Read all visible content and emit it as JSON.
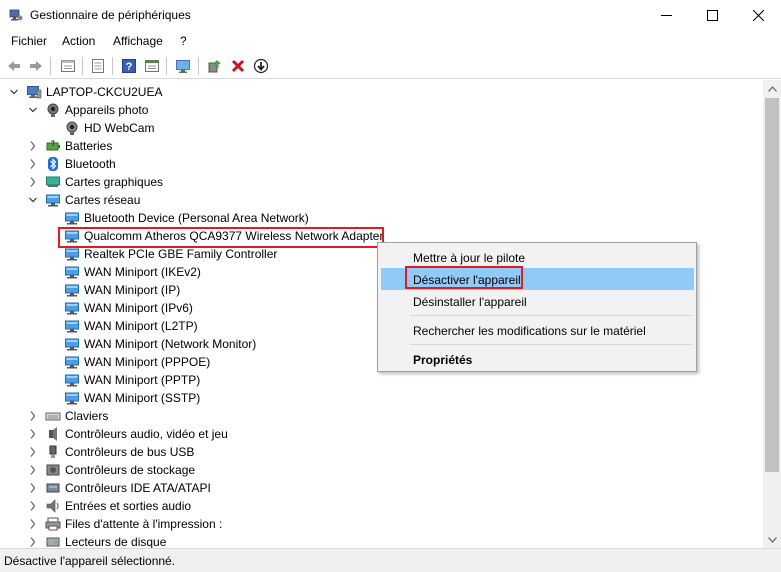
{
  "window": {
    "title": "Gestionnaire de périphériques",
    "controls": [
      "minimize",
      "maximize",
      "close"
    ]
  },
  "menubar": {
    "items": [
      "Fichier",
      "Action",
      "Affichage",
      "?"
    ]
  },
  "toolbar": {
    "buttons": [
      "back-arrow-icon",
      "forward-arrow-icon",
      "properties-sheet-icon",
      "list-view-icon",
      "help-icon",
      "action-panel-icon",
      "monitor-scan-icon",
      "update-driver-icon",
      "uninstall-x-icon",
      "disable-down-arrow-icon"
    ]
  },
  "tree": {
    "root": "LAPTOP-CKCU2UEA",
    "items": [
      {
        "label": "Appareils photo",
        "level": 1,
        "state": "expanded",
        "icon": "camera-icon"
      },
      {
        "label": "HD WebCam",
        "level": 2,
        "state": "leaf",
        "icon": "webcam-icon"
      },
      {
        "label": "Batteries",
        "level": 1,
        "state": "collapsed",
        "icon": "battery-icon"
      },
      {
        "label": "Bluetooth",
        "level": 1,
        "state": "collapsed",
        "icon": "bluetooth-icon"
      },
      {
        "label": "Cartes graphiques",
        "level": 1,
        "state": "collapsed",
        "icon": "display-adapter-icon"
      },
      {
        "label": "Cartes réseau",
        "level": 1,
        "state": "expanded",
        "icon": "network-adapter-icon"
      },
      {
        "label": "Bluetooth Device (Personal Area Network)",
        "level": 2,
        "state": "leaf",
        "icon": "network-adapter-icon"
      },
      {
        "label": "Qualcomm Atheros QCA9377 Wireless Network Adapter",
        "level": 2,
        "state": "leaf",
        "icon": "network-adapter-icon",
        "selected": true
      },
      {
        "label": "Realtek PCIe GBE Family Controller",
        "level": 2,
        "state": "leaf",
        "icon": "network-adapter-icon"
      },
      {
        "label": "WAN Miniport (IKEv2)",
        "level": 2,
        "state": "leaf",
        "icon": "network-adapter-icon"
      },
      {
        "label": "WAN Miniport (IP)",
        "level": 2,
        "state": "leaf",
        "icon": "network-adapter-icon"
      },
      {
        "label": "WAN Miniport (IPv6)",
        "level": 2,
        "state": "leaf",
        "icon": "network-adapter-icon"
      },
      {
        "label": "WAN Miniport (L2TP)",
        "level": 2,
        "state": "leaf",
        "icon": "network-adapter-icon"
      },
      {
        "label": "WAN Miniport (Network Monitor)",
        "level": 2,
        "state": "leaf",
        "icon": "network-adapter-icon"
      },
      {
        "label": "WAN Miniport (PPPOE)",
        "level": 2,
        "state": "leaf",
        "icon": "network-adapter-icon"
      },
      {
        "label": "WAN Miniport (PPTP)",
        "level": 2,
        "state": "leaf",
        "icon": "network-adapter-icon"
      },
      {
        "label": "WAN Miniport (SSTP)",
        "level": 2,
        "state": "leaf",
        "icon": "network-adapter-icon"
      },
      {
        "label": "Claviers",
        "level": 1,
        "state": "collapsed",
        "icon": "keyboard-icon"
      },
      {
        "label": "Contrôleurs audio, vidéo et jeu",
        "level": 1,
        "state": "collapsed",
        "icon": "audio-icon"
      },
      {
        "label": "Contrôleurs de bus USB",
        "level": 1,
        "state": "collapsed",
        "icon": "usb-icon"
      },
      {
        "label": "Contrôleurs de stockage",
        "level": 1,
        "state": "collapsed",
        "icon": "storage-icon"
      },
      {
        "label": "Contrôleurs IDE ATA/ATAPI",
        "level": 1,
        "state": "collapsed",
        "icon": "ide-icon"
      },
      {
        "label": "Entrées et sorties audio",
        "level": 1,
        "state": "collapsed",
        "icon": "speaker-icon"
      },
      {
        "label": "Files d'attente à l'impression :",
        "level": 1,
        "state": "collapsed",
        "icon": "printer-icon"
      },
      {
        "label": "Lecteurs de disque",
        "level": 1,
        "state": "collapsed",
        "icon": "disk-icon"
      }
    ]
  },
  "context_menu": {
    "items": [
      {
        "label": "Mettre à jour le pilote",
        "highlighted": false,
        "bold": false
      },
      {
        "label": "Désactiver l'appareil",
        "highlighted": true,
        "bold": false
      },
      {
        "label": "Désinstaller l'appareil",
        "highlighted": false,
        "bold": false
      },
      {
        "label": "Rechercher les modifications sur le matériel",
        "highlighted": false,
        "bold": false
      },
      {
        "label": "Propriétés",
        "highlighted": false,
        "bold": true
      }
    ]
  },
  "statusbar": {
    "text": "Désactive l'appareil sélectionné."
  },
  "colors": {
    "highlight_red": "#e21c1c",
    "menu_hover": "#91c9f7",
    "adapter_blue": "#3a8fd8"
  }
}
